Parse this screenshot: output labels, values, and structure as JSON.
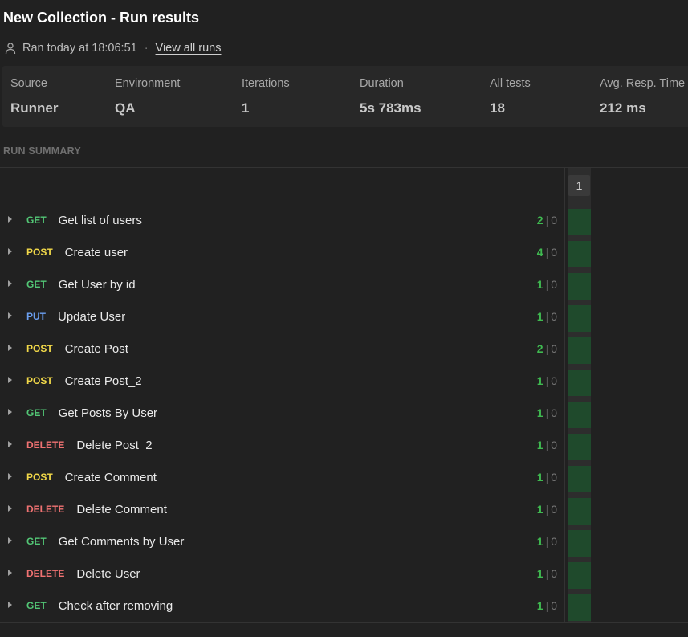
{
  "header": {
    "title": "New Collection - Run results",
    "ran_text": "Ran today at 18:06:51",
    "separator": "·",
    "view_all_runs": "View all runs"
  },
  "stats": [
    {
      "label": "Source",
      "value": "Runner"
    },
    {
      "label": "Environment",
      "value": "QA"
    },
    {
      "label": "Iterations",
      "value": "1"
    },
    {
      "label": "Duration",
      "value": "5s 783ms"
    },
    {
      "label": "All tests",
      "value": "18"
    },
    {
      "label": "Avg. Resp. Time",
      "value": "212 ms"
    }
  ],
  "summary": {
    "title": "RUN SUMMARY",
    "iterations": [
      "1"
    ],
    "pass_color": "#1f4a2c",
    "count_separator": "|"
  },
  "method_colors": {
    "GET": "#53c776",
    "POST": "#f2d949",
    "PUT": "#6b9ff0",
    "DELETE": "#f07272"
  },
  "requests": [
    {
      "method": "GET",
      "name": "Get list of users",
      "passed": "2",
      "failed": "0"
    },
    {
      "method": "POST",
      "name": "Create user",
      "passed": "4",
      "failed": "0"
    },
    {
      "method": "GET",
      "name": "Get User by id",
      "passed": "1",
      "failed": "0"
    },
    {
      "method": "PUT",
      "name": "Update User",
      "passed": "1",
      "failed": "0"
    },
    {
      "method": "POST",
      "name": "Create Post",
      "passed": "2",
      "failed": "0"
    },
    {
      "method": "POST",
      "name": "Create Post_2",
      "passed": "1",
      "failed": "0"
    },
    {
      "method": "GET",
      "name": "Get Posts By User",
      "passed": "1",
      "failed": "0"
    },
    {
      "method": "DELETE",
      "name": "Delete Post_2",
      "passed": "1",
      "failed": "0"
    },
    {
      "method": "POST",
      "name": "Create Comment",
      "passed": "1",
      "failed": "0"
    },
    {
      "method": "DELETE",
      "name": "Delete Comment",
      "passed": "1",
      "failed": "0"
    },
    {
      "method": "GET",
      "name": "Get Comments by User",
      "passed": "1",
      "failed": "0"
    },
    {
      "method": "DELETE",
      "name": "Delete User",
      "passed": "1",
      "failed": "0"
    },
    {
      "method": "GET",
      "name": "Check after removing",
      "passed": "1",
      "failed": "0"
    }
  ]
}
